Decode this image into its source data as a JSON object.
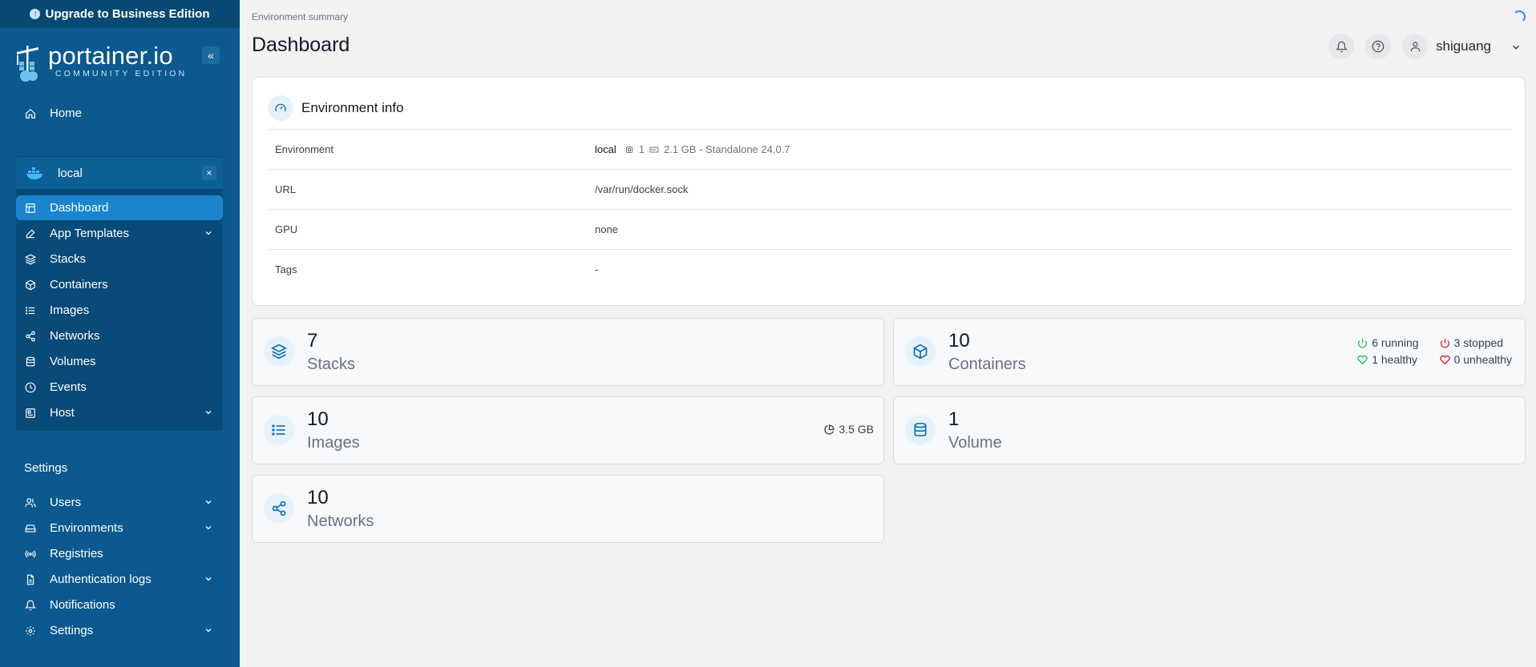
{
  "sidebar": {
    "upgrade_label": "Upgrade to Business Edition",
    "brand": {
      "name": "portainer.io",
      "edition": "COMMUNITY EDITION"
    },
    "home_label": "Home",
    "environment": {
      "name": "local"
    },
    "env_items": [
      {
        "label": "Dashboard",
        "icon": "dashboard-icon"
      },
      {
        "label": "App Templates",
        "icon": "edit-icon"
      },
      {
        "label": "Stacks",
        "icon": "layers-icon"
      },
      {
        "label": "Containers",
        "icon": "box-icon"
      },
      {
        "label": "Images",
        "icon": "list-icon"
      },
      {
        "label": "Networks",
        "icon": "share-icon"
      },
      {
        "label": "Volumes",
        "icon": "database-icon"
      },
      {
        "label": "Events",
        "icon": "clock-icon"
      },
      {
        "label": "Host",
        "icon": "host-icon"
      }
    ],
    "settings_heading": "Settings",
    "settings_items": [
      {
        "label": "Users",
        "icon": "users-icon"
      },
      {
        "label": "Environments",
        "icon": "environments-icon"
      },
      {
        "label": "Registries",
        "icon": "radio-icon"
      },
      {
        "label": "Authentication logs",
        "icon": "file-icon"
      },
      {
        "label": "Notifications",
        "icon": "bell-icon"
      },
      {
        "label": "Settings",
        "icon": "gear-icon"
      }
    ]
  },
  "header": {
    "breadcrumb": "Environment summary",
    "title": "Dashboard",
    "username": "shiguang"
  },
  "env_info": {
    "title": "Environment info",
    "rows": [
      {
        "key": "Environment",
        "value": "local",
        "cpu": "1",
        "memory": "2.1 GB - Standalone 24.0.7"
      },
      {
        "key": "URL",
        "value": "/var/run/docker.sock"
      },
      {
        "key": "GPU",
        "value": "none"
      },
      {
        "key": "Tags",
        "value": "-"
      }
    ]
  },
  "stats": {
    "stacks": {
      "count": "7",
      "label": "Stacks"
    },
    "containers": {
      "count": "10",
      "label": "Containers",
      "running": "6 running",
      "stopped": "3 stopped",
      "healthy": "1 healthy",
      "unhealthy": "0 unhealthy"
    },
    "images": {
      "count": "10",
      "label": "Images",
      "size": "3.5 GB"
    },
    "volumes": {
      "count": "1",
      "label": "Volume"
    },
    "networks": {
      "count": "10",
      "label": "Networks"
    }
  },
  "colors": {
    "sidebar": "#0b598f",
    "active": "#1a84cf",
    "running": "#22c55e",
    "stopped": "#dc2626",
    "accent": "#0b6fb8"
  }
}
